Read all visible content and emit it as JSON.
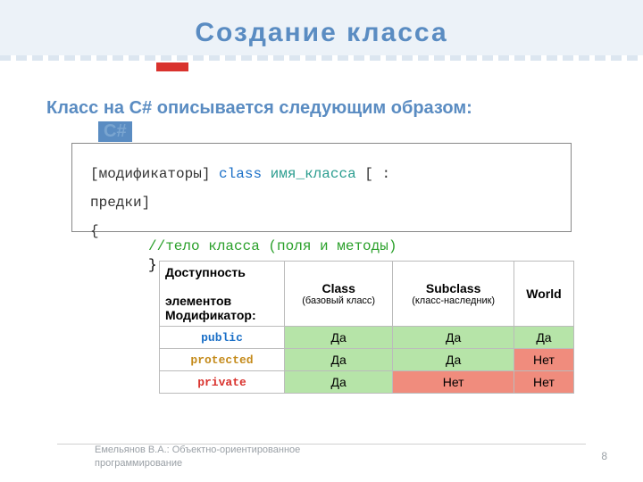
{
  "title": "Создание  класса",
  "subtitle": "Класс  на  С#  описывается  следующим  образом:",
  "tag": "C#",
  "code": {
    "line1_pre": "[модификаторы]  ",
    "kw": "class",
    "line1_mid": "  ",
    "ident": "имя_класса",
    "line1_post": "  [ :  ",
    "line2": "предки]",
    "line3": "        {",
    "comment": "//тело  класса  (поля  и  методы)",
    "close": "}"
  },
  "table": {
    "header_left_1": "Доступность",
    "header_left_2": "элементов",
    "header_left_3": "Модификатор:",
    "col_class": "Class",
    "col_class_sub": "(базовый класс)",
    "col_subclass": "Subclass",
    "col_subclass_sub": "(класс-наследник)",
    "col_world": "World",
    "rows": [
      {
        "mod": "public",
        "class": "Да",
        "subclass": "Да",
        "world": "Да"
      },
      {
        "mod": "protected",
        "class": "Да",
        "subclass": "Да",
        "world": "Нет"
      },
      {
        "mod": "private",
        "class": "Да",
        "subclass": "Нет",
        "world": "Нет"
      }
    ]
  },
  "footer": "Емельянов В.А.: Объектно-ориентированное программирование",
  "page": "8"
}
